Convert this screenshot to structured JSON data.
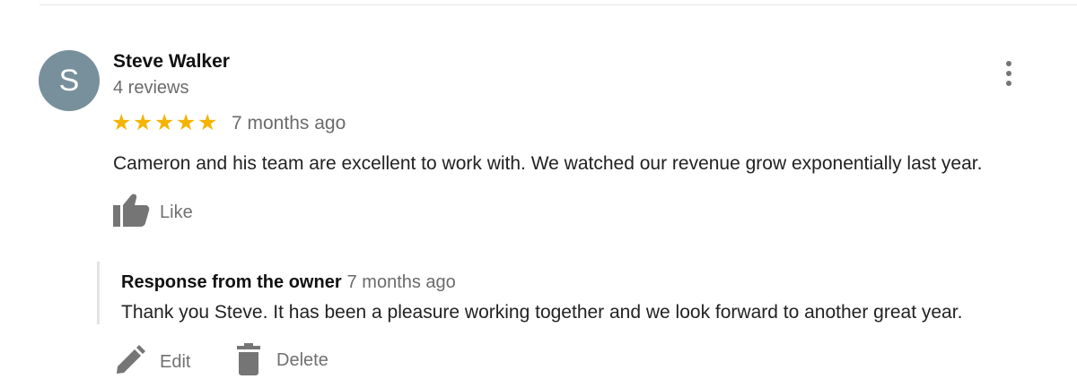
{
  "review": {
    "avatar_initial": "S",
    "reviewer_name": "Steve Walker",
    "review_count": "4 reviews",
    "rating": 5,
    "rating_max": 5,
    "age": "7 months ago",
    "text": "Cameron and his team are excellent to work with. We watched our revenue grow exponentially last year.",
    "like_label": "Like"
  },
  "owner_response": {
    "title": "Response from the owner",
    "age": "7 months ago",
    "text": "Thank you Steve. It has been a pleasure working together and we look forward to another great year."
  },
  "actions": {
    "edit_label": "Edit",
    "delete_label": "Delete"
  },
  "colors": {
    "avatar": "#78909c",
    "star": "#f4b400",
    "secondary_text": "#6b6b6b",
    "icon": "#757575"
  },
  "icons": [
    "more-vert-icon",
    "star-icon",
    "thumbs-up-icon",
    "pencil-icon",
    "trash-icon"
  ]
}
